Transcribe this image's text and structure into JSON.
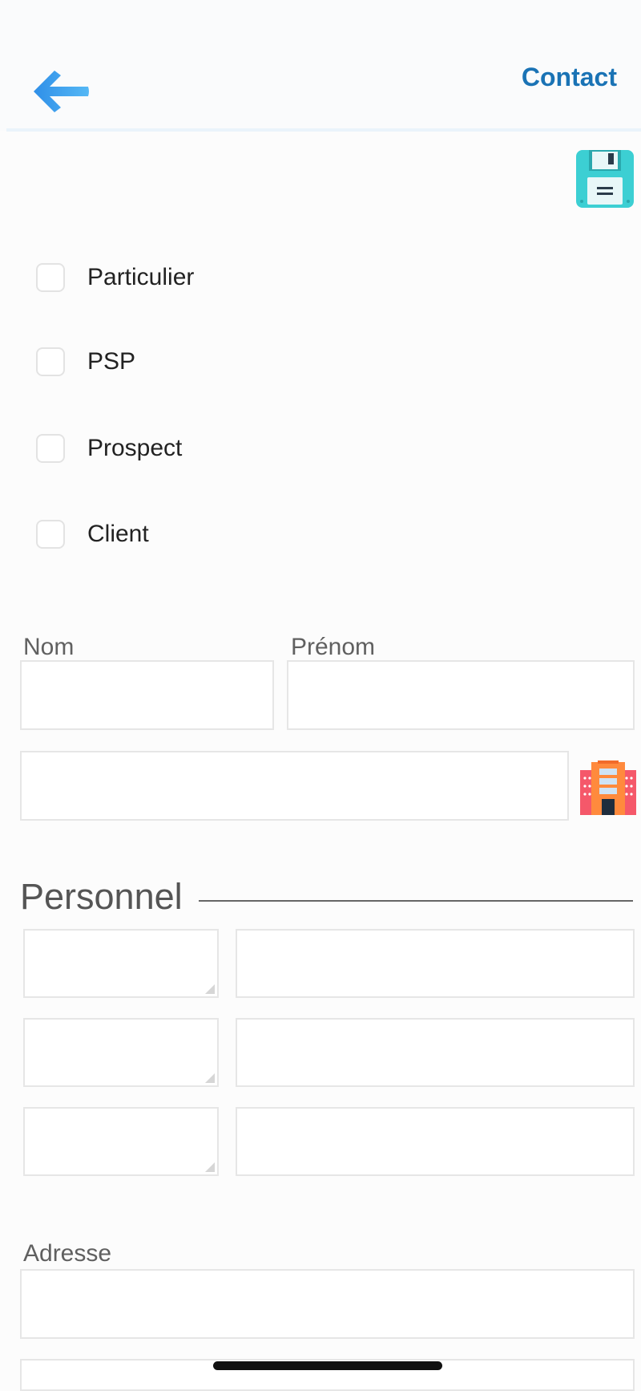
{
  "header": {
    "title": "Contact",
    "back_icon": "back-arrow-icon",
    "accent_color": "#1a73b5"
  },
  "toolbar": {
    "save_icon": "floppy-disk-icon"
  },
  "checkboxes": [
    {
      "label": "Particulier",
      "checked": false
    },
    {
      "label": "PSP",
      "checked": false
    },
    {
      "label": "Prospect",
      "checked": false
    },
    {
      "label": "Client",
      "checked": false
    }
  ],
  "form": {
    "nom_label": "Nom",
    "nom_value": "",
    "prenom_label": "Prénom",
    "prenom_value": "",
    "company_value": "",
    "company_icon": "building-icon",
    "section_personnel": "Personnel",
    "personnel_rows": [
      {
        "type_value": "",
        "value": ""
      },
      {
        "type_value": "",
        "value": ""
      },
      {
        "type_value": "",
        "value": ""
      }
    ],
    "adresse_label": "Adresse",
    "adresse_value": "",
    "adresse2_value": ""
  }
}
